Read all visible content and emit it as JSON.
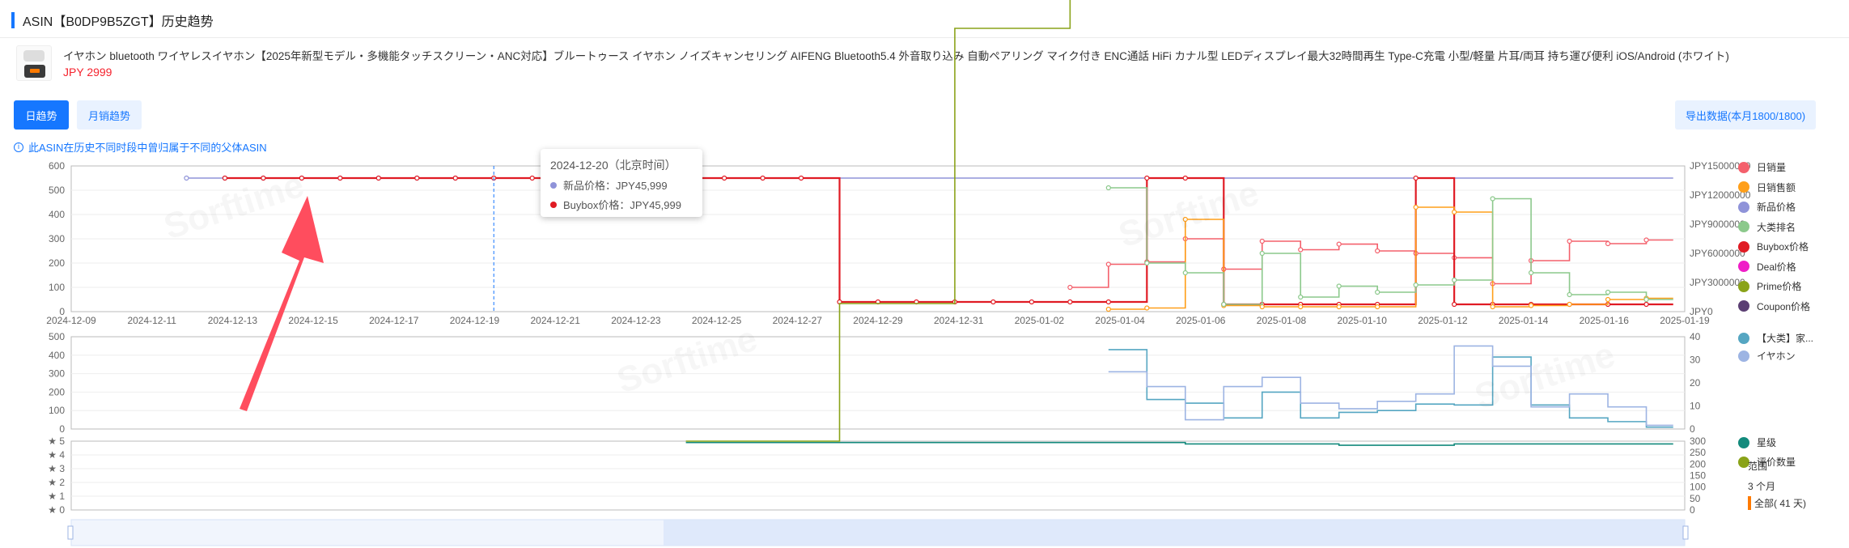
{
  "header": {
    "title": "ASIN【B0DP9B5ZGT】历史趋势"
  },
  "product": {
    "title": "イヤホン bluetooth ワイヤレスイヤホン【2025年新型モデル・多機能タッチスクリーン・ANC対応】ブルートゥース イヤホン ノイズキャンセリング AIFENG Bluetooth5.4 外音取り込み 自動ペアリング マイク付き ENC通話 HiFi カナル型 LEDディスプレイ最大32時間再生 Type-C充電 小型/軽量 片耳/両耳 持ち運び便利 iOS/Android (ホワイト)",
    "price": "JPY 2999"
  },
  "tabs": {
    "daily": "日趋势",
    "monthly": "月销趋势"
  },
  "export_label": "导出数据(本月1800/1800)",
  "notice": "此ASIN在历史不同时段中曾归属于不同的父体ASIN",
  "tooltip": {
    "date": "2024-12-20（北京时间）",
    "line1": "新品价格：JPY45,999",
    "line2": "Buybox价格：JPY45,999"
  },
  "colors": {
    "sales_qty": "#f4606c",
    "sales_amount": "#ff9f1a",
    "new_price": "#8f93d9",
    "big_rank": "#8cc98c",
    "buybox": "#e01b24",
    "deal": "#ef1ec7",
    "prime": "#8aa319",
    "coupon": "#5b3f73",
    "cat_rank": "#55a6c2",
    "sub_rank": "#9db4e3",
    "star": "#138a7c",
    "reviews": "#8aa319"
  },
  "legend": {
    "top": [
      "日销量",
      "日销售额",
      "新品价格",
      "大类排名",
      "Buybox价格",
      "Deal价格",
      "Prime价格",
      "Coupon价格"
    ],
    "mid": [
      "【大类】家...",
      "イヤホン"
    ],
    "bottom": [
      "星级",
      "评价数量"
    ]
  },
  "range": {
    "label": "范围",
    "m3": "3 个月",
    "all": "全部( 41 天)"
  },
  "chart_data": [
    {
      "type": "line",
      "name": "top",
      "x_ticks": [
        "2024-12-09",
        "2024-12-11",
        "2024-12-13",
        "2024-12-15",
        "2024-12-17",
        "2024-12-19",
        "2024-12-21",
        "2024-12-23",
        "2024-12-25",
        "2024-12-27",
        "2024-12-29",
        "2024-12-31",
        "2025-01-02",
        "2025-01-04",
        "2025-01-06",
        "2025-01-08",
        "2025-01-10",
        "2025-01-12",
        "2025-01-14",
        "2025-01-16",
        "2025-01-19"
      ],
      "y_left_ticks": [
        "0",
        "100",
        "200",
        "300",
        "400",
        "500",
        "600"
      ],
      "y_right_ticks": [
        "JPY0",
        "JPY3000000",
        "JPY6000000",
        "JPY9000000",
        "JPY12000000",
        "JPY15000000"
      ],
      "ylim": [
        0,
        600
      ],
      "series": [
        {
          "name": "日销量",
          "color": "#f4606c",
          "x": [
            26,
            27,
            28,
            29,
            30,
            31,
            32,
            33,
            34,
            35,
            36,
            37,
            38,
            39,
            40,
            41
          ],
          "values": [
            100,
            195,
            205,
            300,
            175,
            290,
            255,
            278,
            250,
            240,
            222,
            115,
            210,
            290,
            280,
            295
          ]
        },
        {
          "name": "新品价格",
          "color": "#8f93d9",
          "x": [
            3,
            4,
            5,
            6,
            7,
            8,
            9,
            10,
            11
          ],
          "values": [
            550,
            550,
            550,
            550,
            550,
            550,
            550,
            550,
            550
          ]
        },
        {
          "name": "Buybox价格",
          "color": "#e01b24",
          "x": [
            4,
            5,
            6,
            7,
            8,
            9,
            10,
            11,
            12,
            13,
            14,
            15,
            16,
            17,
            18,
            19,
            20,
            21,
            22,
            23,
            24,
            25,
            26,
            27,
            28,
            29,
            30,
            31,
            32,
            33,
            34,
            35,
            36,
            37,
            38,
            39,
            40,
            41
          ],
          "values": [
            550,
            550,
            550,
            550,
            550,
            550,
            550,
            550,
            550,
            550,
            550,
            550,
            550,
            550,
            550,
            550,
            40,
            40,
            40,
            40,
            40,
            40,
            40,
            40,
            550,
            550,
            30,
            30,
            30,
            30,
            30,
            550,
            30,
            30,
            30,
            30,
            30,
            30
          ]
        },
        {
          "name": "日销售额",
          "color": "#ff9f1a",
          "x": [
            27,
            28,
            29,
            30,
            31,
            32,
            33,
            34,
            35,
            36,
            37,
            38,
            39,
            40,
            41
          ],
          "values": [
            10,
            15,
            380,
            25,
            20,
            20,
            20,
            20,
            430,
            410,
            20,
            25,
            30,
            50,
            55
          ]
        },
        {
          "name": "大类排名",
          "color": "#8cc98c",
          "x": [
            27,
            28,
            29,
            30,
            31,
            32,
            33,
            34,
            35,
            36,
            37,
            38,
            39,
            40,
            41
          ],
          "values": [
            510,
            200,
            160,
            30,
            240,
            60,
            105,
            80,
            110,
            130,
            465,
            160,
            70,
            80,
            50
          ]
        }
      ]
    },
    {
      "type": "line",
      "name": "middle",
      "y_left_ticks": [
        "0",
        "100",
        "200",
        "300",
        "400",
        "500"
      ],
      "y_right_ticks": [
        "0",
        "10",
        "20",
        "30",
        "40"
      ],
      "ylim": [
        0,
        500
      ],
      "series": [
        {
          "name": "【大类】家...",
          "color": "#55a6c2",
          "x": [
            27,
            28,
            29,
            30,
            31,
            32,
            33,
            34,
            35,
            36,
            37,
            38,
            39,
            40,
            41
          ],
          "values": [
            430,
            160,
            140,
            60,
            200,
            60,
            90,
            100,
            135,
            130,
            390,
            130,
            60,
            40,
            10
          ]
        },
        {
          "name": "イヤホン",
          "color": "#9db4e3",
          "x": [
            27,
            28,
            29,
            30,
            31,
            32,
            33,
            34,
            35,
            36,
            37,
            38,
            39,
            40,
            41
          ],
          "values": [
            310,
            230,
            50,
            230,
            280,
            140,
            110,
            150,
            190,
            450,
            340,
            120,
            190,
            120,
            20
          ]
        }
      ]
    },
    {
      "type": "line",
      "name": "bottom",
      "y_left_ticks": [
        "★ 0",
        "★ 1",
        "★ 2",
        "★ 3",
        "★ 4",
        "★ 5"
      ],
      "y_right_ticks": [
        "0",
        "50",
        "100",
        "150",
        "200",
        "250",
        "300"
      ],
      "ylim": [
        0,
        5
      ],
      "series": [
        {
          "name": "星级",
          "color": "#138a7c",
          "x": [
            16,
            20,
            23,
            26,
            29,
            33,
            36,
            41
          ],
          "values": [
            4.9,
            4.9,
            4.9,
            4.9,
            4.8,
            4.7,
            4.8,
            4.8
          ]
        },
        {
          "name": "评价数量",
          "color": "#8aa319",
          "x": [
            16,
            20,
            23,
            26,
            29,
            31,
            33,
            35,
            37,
            39,
            41
          ],
          "values": [
            5,
            15,
            35,
            50,
            70,
            110,
            150,
            190,
            240,
            270,
            290
          ]
        }
      ]
    }
  ]
}
